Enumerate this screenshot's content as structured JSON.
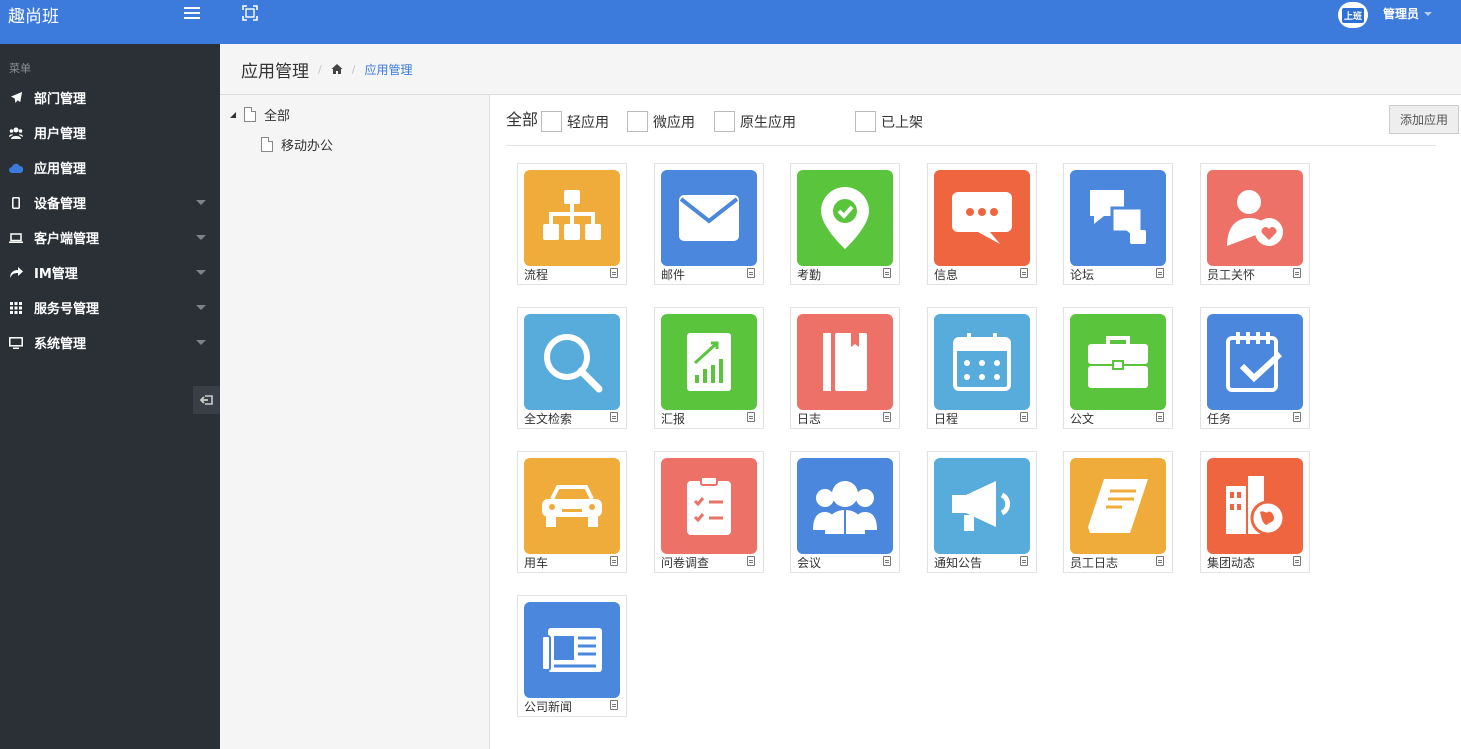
{
  "brand": {
    "title": "趣尚班"
  },
  "sidebar": {
    "caption": "菜单",
    "items": [
      {
        "label": "部门管理",
        "icon": "paper-plane-icon",
        "has_submenu": false
      },
      {
        "label": "用户管理",
        "icon": "users-icon",
        "has_submenu": false
      },
      {
        "label": "应用管理",
        "icon": "cloud-icon",
        "has_submenu": false,
        "active_icon_color": "#3c7bdb"
      },
      {
        "label": "设备管理",
        "icon": "mobile-icon",
        "has_submenu": true
      },
      {
        "label": "客户端管理",
        "icon": "laptop-icon",
        "has_submenu": true
      },
      {
        "label": "IM管理",
        "icon": "share-icon",
        "has_submenu": true
      },
      {
        "label": "服务号管理",
        "icon": "grid-icon",
        "has_submenu": true
      },
      {
        "label": "系统管理",
        "icon": "desktop-icon",
        "has_submenu": true
      }
    ]
  },
  "topbar": {
    "avatar_text": "上班",
    "user_name": "管理员"
  },
  "header": {
    "title": "应用管理",
    "breadcrumb_current": "应用管理"
  },
  "tree": {
    "root": {
      "label": "全部"
    },
    "children": [
      {
        "label": "移动办公"
      }
    ]
  },
  "filters": {
    "all_label": "全部",
    "options": [
      "轻应用",
      "微应用",
      "原生应用",
      "已上架"
    ],
    "add_button": "添加应用"
  },
  "apps": [
    {
      "name": "流程",
      "color": "#f0ac3a",
      "icon": "org-chart-icon"
    },
    {
      "name": "邮件",
      "color": "#4a87dd",
      "icon": "envelope-icon"
    },
    {
      "name": "考勤",
      "color": "#5ac43c",
      "icon": "map-pin-check-icon"
    },
    {
      "name": "信息",
      "color": "#ef6540",
      "icon": "chat-bubble-icon"
    },
    {
      "name": "论坛",
      "color": "#4a87dd",
      "icon": "discussion-icon"
    },
    {
      "name": "员工关怀",
      "color": "#ee7168",
      "icon": "user-heart-icon"
    },
    {
      "name": "全文检索",
      "color": "#58acdc",
      "icon": "search-icon"
    },
    {
      "name": "汇报",
      "color": "#5ac43c",
      "icon": "report-chart-icon"
    },
    {
      "name": "日志",
      "color": "#ee7168",
      "icon": "notebook-icon"
    },
    {
      "name": "日程",
      "color": "#58acdc",
      "icon": "calendar-icon"
    },
    {
      "name": "公文",
      "color": "#5ac43c",
      "icon": "briefcase-icon"
    },
    {
      "name": "任务",
      "color": "#4a87dd",
      "icon": "task-check-icon"
    },
    {
      "name": "用车",
      "color": "#f0ac3a",
      "icon": "car-icon"
    },
    {
      "name": "问卷调查",
      "color": "#ee7168",
      "icon": "clipboard-icon"
    },
    {
      "name": "会议",
      "color": "#4a87dd",
      "icon": "people-group-icon"
    },
    {
      "name": "通知公告",
      "color": "#58acdc",
      "icon": "megaphone-icon"
    },
    {
      "name": "员工日志",
      "color": "#f0ac3a",
      "icon": "book-icon"
    },
    {
      "name": "集团动态",
      "color": "#ef6540",
      "icon": "building-globe-icon"
    },
    {
      "name": "公司新闻",
      "color": "#4a87dd",
      "icon": "newspaper-icon"
    }
  ]
}
